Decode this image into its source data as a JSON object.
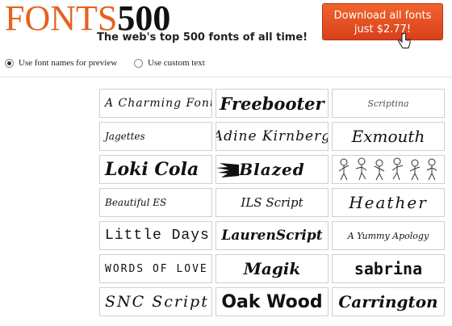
{
  "header": {
    "logo_word": "FONTS",
    "logo_number": "500",
    "tagline": "The web's top 500 fonts of all time!",
    "cta_line1": "Download all fonts",
    "cta_line2": "just $2.77!"
  },
  "options": {
    "font_names": "Use font names for preview",
    "custom_text": "Use custom text",
    "selected": "font_names"
  },
  "fonts": [
    "A Charming Font",
    "Freebooter",
    "Scriptina",
    "Jagettes",
    "Adine Kirnberg",
    "Exmouth",
    "Loki Cola",
    "Blazed",
    "",
    "Beautiful ES",
    "ILS Script",
    "Heather",
    "Little Days",
    "LaurenScript",
    "A Yummy Apology",
    "WORDS OF LOVE",
    "Magik",
    "sabrina",
    "SNC Script",
    "Oak Wood",
    "Carrington"
  ],
  "colors": {
    "accent": "#e8601c",
    "cta_bg": "#e0481f"
  }
}
